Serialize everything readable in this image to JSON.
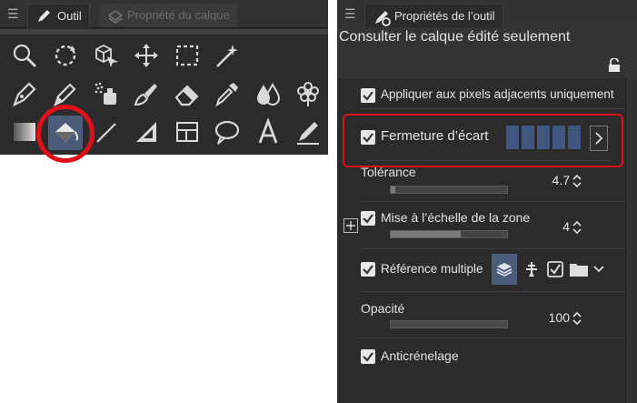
{
  "left_panel": {
    "tabs": [
      {
        "label": "Outil",
        "active": true
      },
      {
        "label": "Propriété du calque",
        "active": false
      }
    ],
    "selected_tool": "fill-icon",
    "tools_row1": [
      "magnifier-icon",
      "rotate-icon",
      "object-select-icon",
      "move-icon",
      "selection-rect-icon",
      "auto-select-wand-icon"
    ],
    "tools_row2": [
      "pen-icon",
      "pencil-icon",
      "airbrush-icon",
      "brush-icon",
      "eraser-icon",
      "eyedropper-icon",
      "blend-drops-icon",
      "decoration-flower-icon"
    ],
    "tools_row3": [
      "gradient-icon",
      "fill-icon",
      "figure-line-icon",
      "ruler-icon",
      "frame-border-icon",
      "balloon-icon",
      "text-icon",
      "correct-line-icon"
    ]
  },
  "right_panel": {
    "tab_label": "Propriétés de l’outil",
    "header_title": "Consulter le calque édité seulement",
    "adjacent": {
      "label": "Appliquer aux pixels adjacents uniquement",
      "checked": true
    },
    "gap_closing": {
      "label": "Fermeture d’écart",
      "checked": true,
      "level": 0.8
    },
    "tolerance": {
      "label": "Tolérance",
      "value": "4.7",
      "fraction": 0.047
    },
    "area_scaling": {
      "label": "Mise à l’échelle de la zone",
      "value": "4",
      "checked": true,
      "fraction": 0.6
    },
    "multiple_ref": {
      "label": "Référence multiple",
      "checked": true
    },
    "opacity": {
      "label": "Opacité",
      "value": "100",
      "fraction": 1.0
    },
    "antialias": {
      "label": "Anticrénelage",
      "checked": true
    }
  },
  "colors": {
    "accent": "#4b5c7a",
    "highlight": "#e0101a",
    "panel": "#2b2b2b"
  }
}
